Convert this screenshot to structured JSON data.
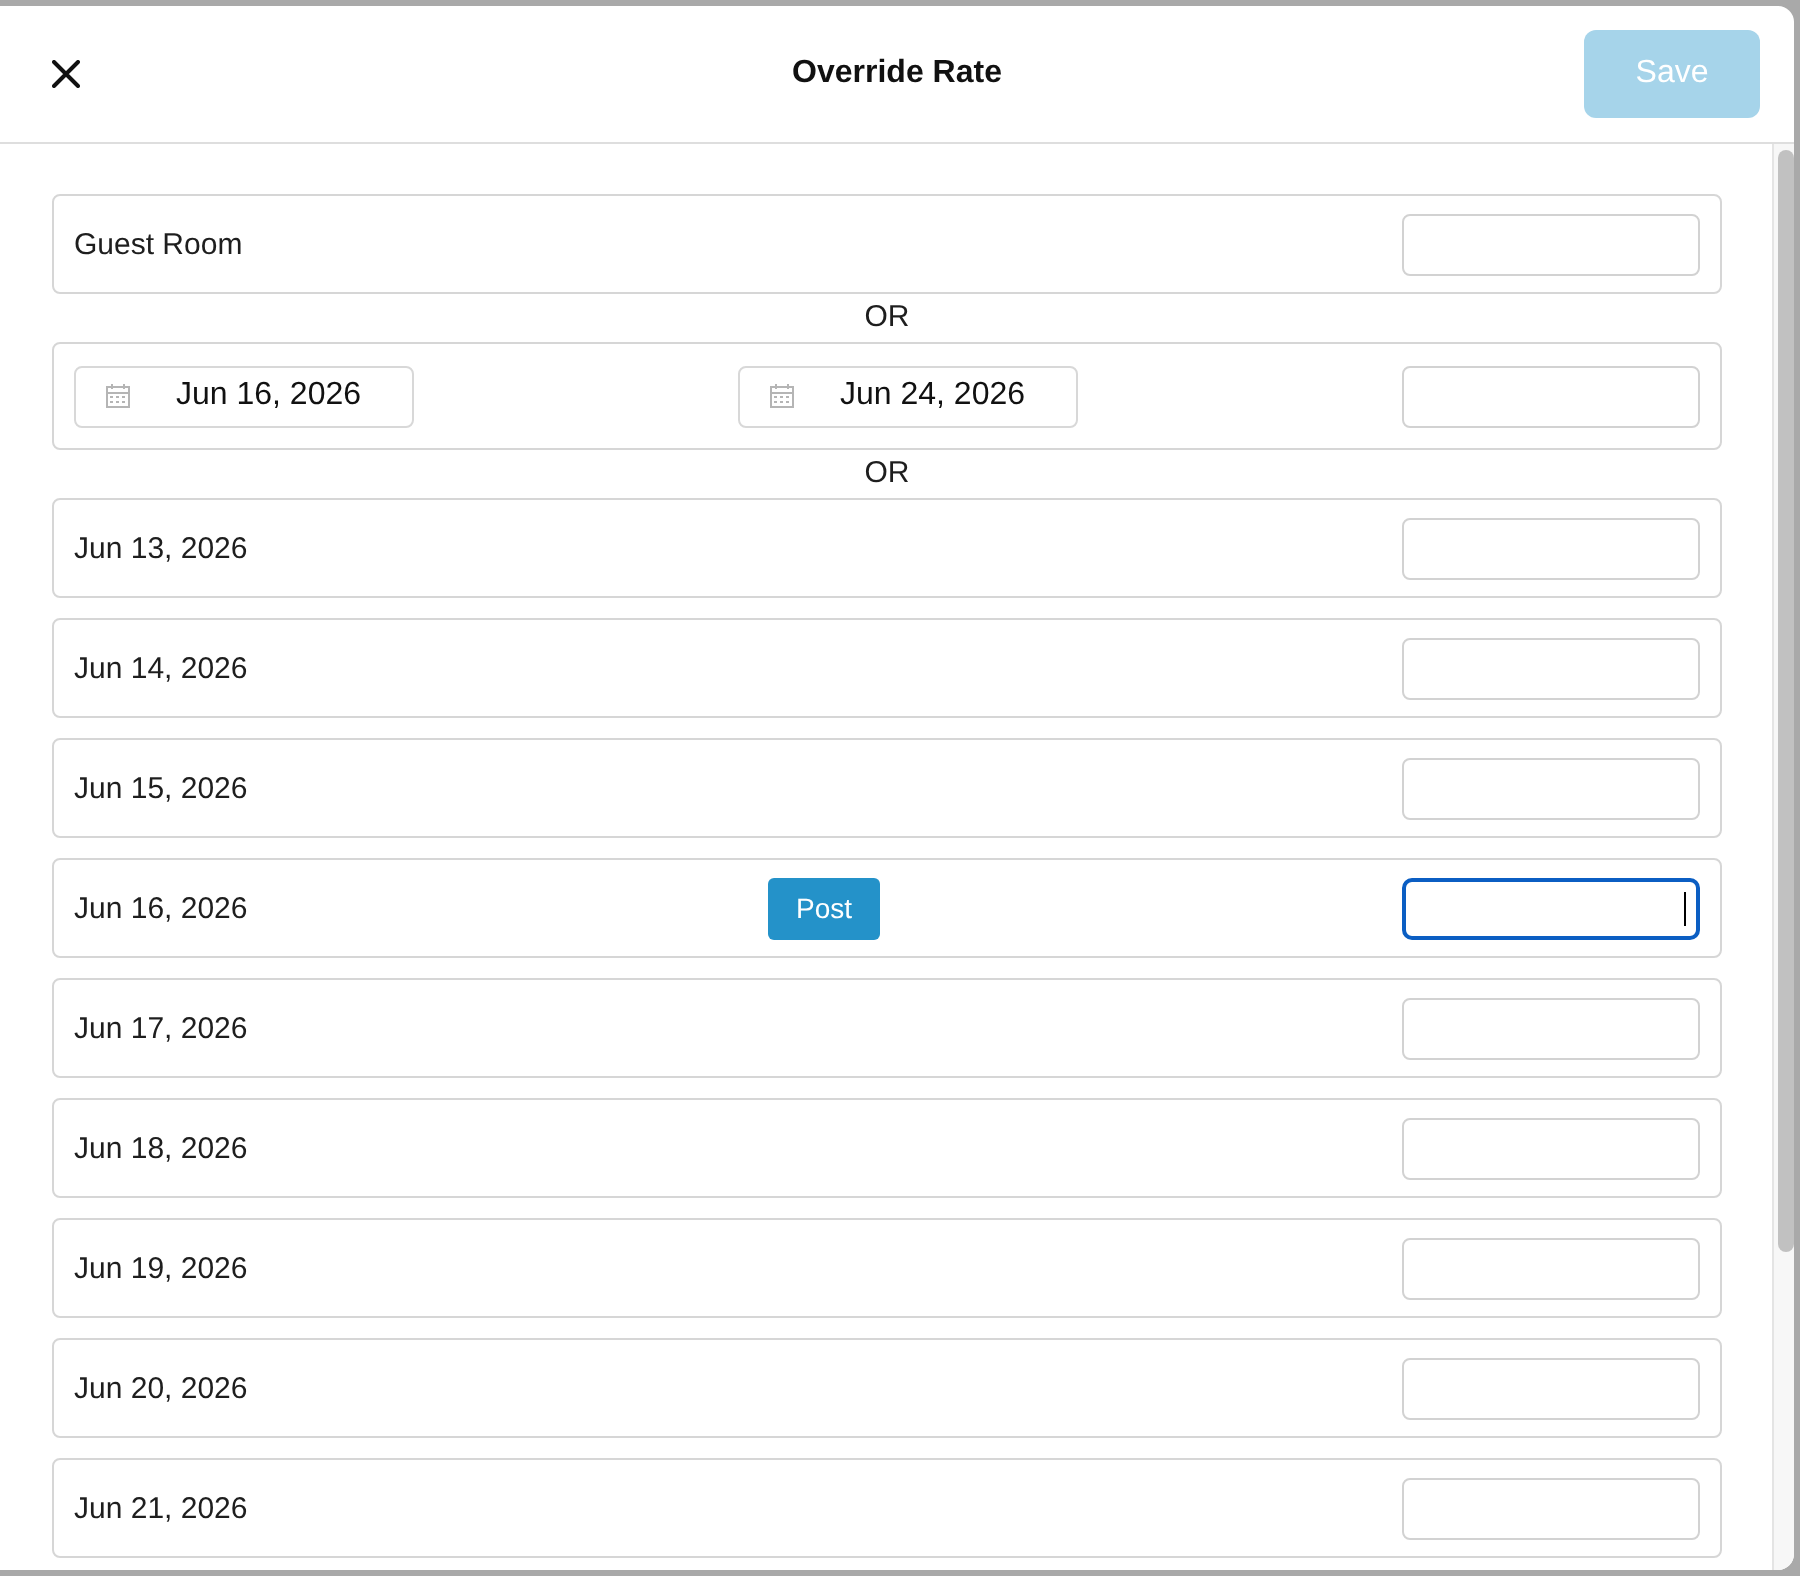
{
  "dialog": {
    "title": "Override Rate",
    "save_button": {
      "label": "Save",
      "disabled": true
    }
  },
  "blocks": [
    {
      "kind": "rate_row",
      "label": "Guest Room",
      "focused": false
    },
    {
      "kind": "separator",
      "text": "OR"
    },
    {
      "kind": "date_range",
      "start": "Jun 16, 2026",
      "end": "Jun 24, 2026",
      "focused": false
    },
    {
      "kind": "separator",
      "text": "OR"
    }
  ],
  "dates": [
    {
      "date": "Jun 13, 2026",
      "focused": false
    },
    {
      "date": "Jun 14, 2026",
      "focused": false
    },
    {
      "date": "Jun 15, 2026",
      "focused": false
    },
    {
      "date": "Jun 16, 2026",
      "focused": true,
      "action": "Post"
    },
    {
      "date": "Jun 17, 2026",
      "focused": false
    },
    {
      "date": "Jun 18, 2026",
      "focused": false
    },
    {
      "date": "Jun 19, 2026",
      "focused": false
    },
    {
      "date": "Jun 20, 2026",
      "focused": false
    },
    {
      "date": "Jun 21, 2026",
      "focused": false
    }
  ]
}
